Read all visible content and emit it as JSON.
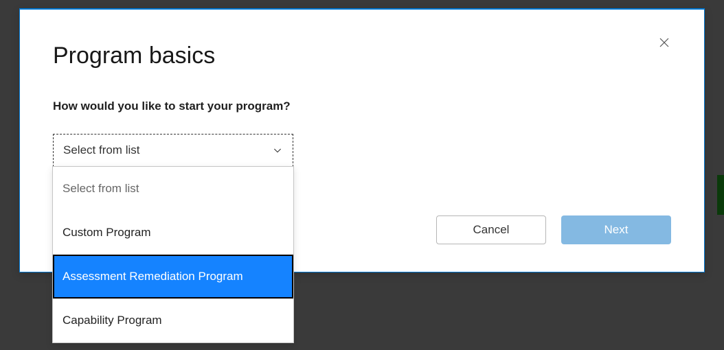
{
  "modal": {
    "title": "Program basics",
    "question": "How would you like to start your program?",
    "dropdown": {
      "selected": "Select from list",
      "options": [
        {
          "label": "Select from list",
          "state": "placeholder"
        },
        {
          "label": "Custom Program",
          "state": "normal"
        },
        {
          "label": "Assessment Remediation Program",
          "state": "highlighted"
        },
        {
          "label": "Capability Program",
          "state": "normal"
        }
      ]
    },
    "buttons": {
      "cancel": "Cancel",
      "next": "Next"
    }
  }
}
